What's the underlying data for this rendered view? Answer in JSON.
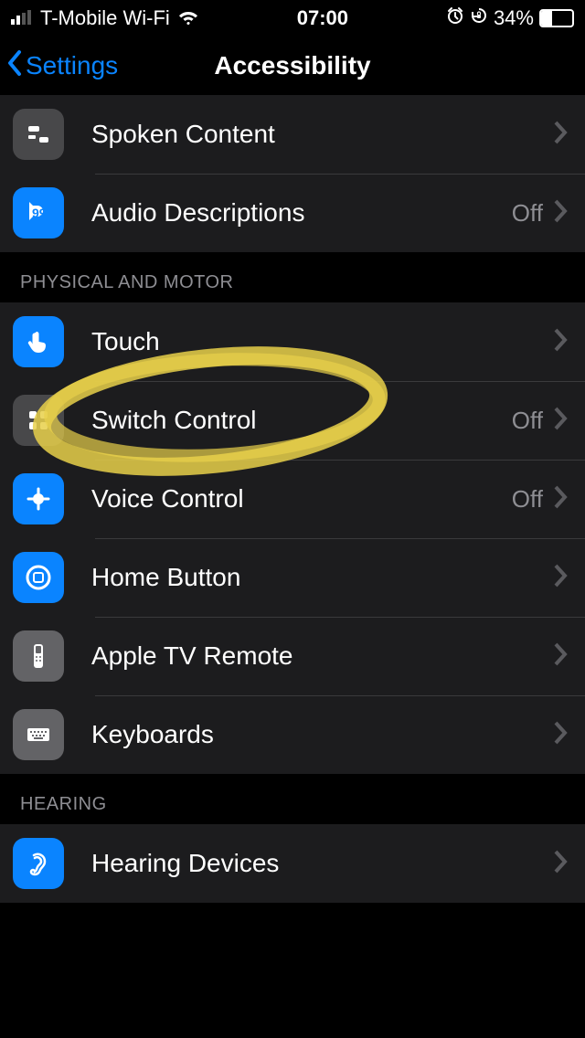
{
  "status": {
    "carrier": "T-Mobile Wi-Fi",
    "time": "07:00",
    "battery_pct": "34%"
  },
  "nav": {
    "back_label": "Settings",
    "title": "Accessibility"
  },
  "groups": {
    "top": {
      "items": [
        {
          "label": "Spoken Content",
          "value": ""
        },
        {
          "label": "Audio Descriptions",
          "value": "Off"
        }
      ]
    },
    "motor": {
      "header": "PHYSICAL AND MOTOR",
      "items": [
        {
          "label": "Touch",
          "value": ""
        },
        {
          "label": "Switch Control",
          "value": "Off"
        },
        {
          "label": "Voice Control",
          "value": "Off"
        },
        {
          "label": "Home Button",
          "value": ""
        },
        {
          "label": "Apple TV Remote",
          "value": ""
        },
        {
          "label": "Keyboards",
          "value": ""
        }
      ]
    },
    "hearing": {
      "header": "HEARING",
      "items": [
        {
          "label": "Hearing Devices",
          "value": ""
        }
      ]
    }
  },
  "annotation": {
    "circled_item": "Switch Control"
  }
}
